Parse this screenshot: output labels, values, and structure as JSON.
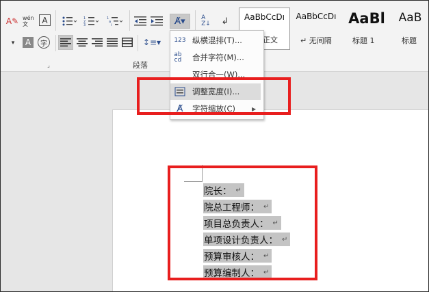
{
  "ribbon": {
    "phonetic_guide_icon": "wén 文",
    "char_border_icon": "A",
    "char_shading_icon": "A",
    "enclose_char_icon": "字",
    "group_paragraph_label": "段落"
  },
  "styles": [
    {
      "sample": "AaBbCcDı",
      "name": "正文"
    },
    {
      "sample": "AaBbCcDı",
      "name": "↵ 无间隔"
    },
    {
      "sample": "AaBl",
      "name": "标题 1"
    },
    {
      "sample": "AaB",
      "name": "标题"
    }
  ],
  "menu": {
    "items": [
      {
        "icon": "123",
        "label": "纵横混排(T)..."
      },
      {
        "icon": "ab cd",
        "label": "合并字符(M)..."
      },
      {
        "icon": "",
        "label": "双行合一(W)..."
      },
      {
        "icon": "",
        "label": "调整宽度(I)..."
      },
      {
        "icon": "",
        "label": "字符缩放(C)"
      }
    ]
  },
  "document": {
    "lines": [
      "院长：",
      "院总工程师：",
      "项目总负责人：",
      "单项设计负责人：",
      "预算审核人：",
      "预算编制人："
    ],
    "paragraph_mark": "↵"
  }
}
